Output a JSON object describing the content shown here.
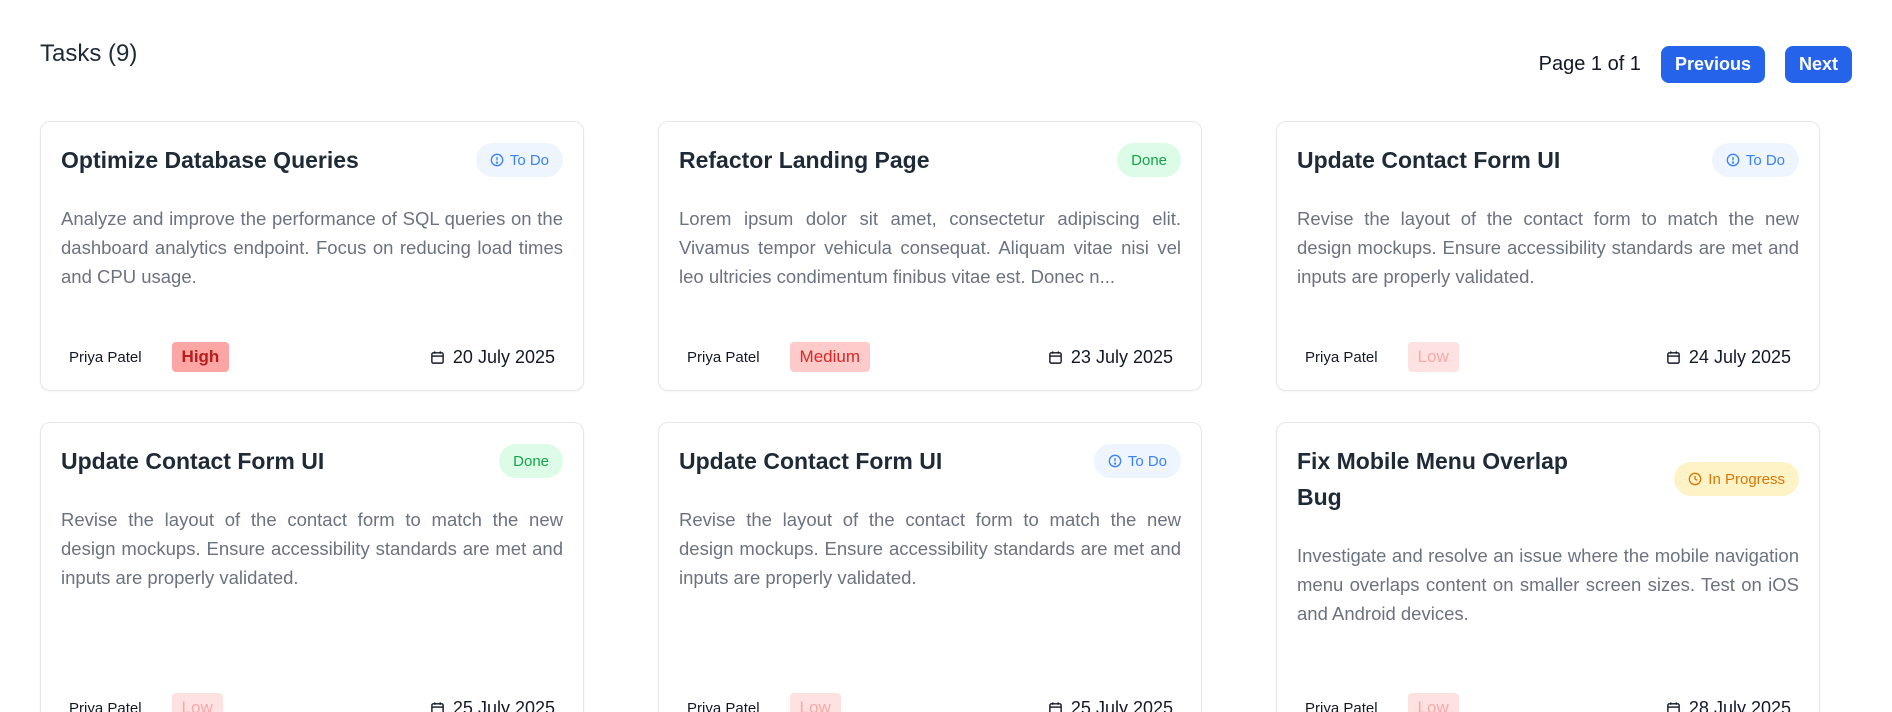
{
  "header": {
    "title": "Tasks (9)"
  },
  "pagination": {
    "indicator": "Page 1 of 1",
    "previous_label": "Previous",
    "next_label": "Next"
  },
  "tasks": [
    {
      "title": "Optimize Database Queries",
      "status": "To Do",
      "description": "Analyze and improve the performance of SQL queries on the dashboard analytics endpoint. Focus on reducing load times and CPU usage.",
      "assignee": "Priya Patel",
      "priority": "High",
      "due_date": "20 July 2025"
    },
    {
      "title": "Refactor Landing Page",
      "status": "Done",
      "description": "Lorem ipsum dolor sit amet, consectetur adipiscing elit. Vivamus tempor vehicula consequat. Aliquam vitae nisi vel leo ultricies condimentum finibus vitae est. Donec n...",
      "assignee": "Priya Patel",
      "priority": "Medium",
      "due_date": "23 July 2025"
    },
    {
      "title": "Update Contact Form UI",
      "status": "To Do",
      "description": "Revise the layout of the contact form to match the new design mockups. Ensure accessibility standards are met and inputs are properly validated.",
      "assignee": "Priya Patel",
      "priority": "Low",
      "due_date": "24 July 2025"
    },
    {
      "title": "Update Contact Form UI",
      "status": "Done",
      "description": "Revise the layout of the contact form to match the new design mockups. Ensure accessibility standards are met and inputs are properly validated.",
      "assignee": "Priya Patel",
      "priority": "Low",
      "due_date": "25 July 2025"
    },
    {
      "title": "Update Contact Form UI",
      "status": "To Do",
      "description": "Revise the layout of the contact form to match the new design mockups. Ensure accessibility standards are met and inputs are properly validated.",
      "assignee": "Priya Patel",
      "priority": "Low",
      "due_date": "25 July 2025"
    },
    {
      "title": "Fix Mobile Menu Overlap Bug",
      "status": "In Progress",
      "description": "Investigate and resolve an issue where the mobile navigation menu overlaps content on smaller screen sizes. Test on iOS and Android devices.",
      "assignee": "Priya Patel",
      "priority": "Low",
      "due_date": "28 July 2025"
    }
  ],
  "icons": {
    "status_todo": "info-circle-icon",
    "status_progress": "clock-icon",
    "due_date": "calendar-icon"
  },
  "colors": {
    "primary": "#2563eb",
    "todo": "#3b82f6",
    "done": "#16a34a",
    "in_progress": "#d97706",
    "high": "#b91c1c"
  }
}
